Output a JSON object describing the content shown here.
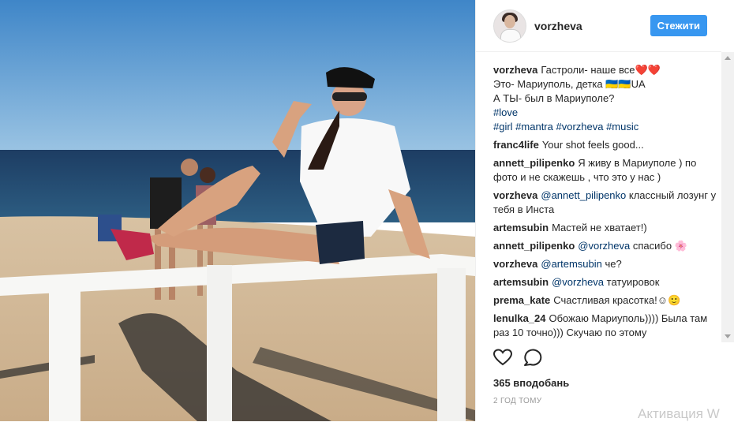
{
  "post": {
    "photo_alt": "",
    "author": "vorzheva",
    "follow_label": "Стежити",
    "caption": {
      "author": "vorzheva",
      "lines": [
        "Гастроли- наше все❤️❤️",
        "Это- Мариуполь, детка 🇺🇦🇺🇦UA",
        "А ТЫ- был в Мариуполе?"
      ],
      "tags_line1": "#love",
      "tags_line2": "#girl #mantra #vorzheva #music"
    },
    "comments": [
      {
        "author": "franc4life",
        "text": "Your shot feels good..."
      },
      {
        "author": "annett_pilipenko",
        "text": "Я живу в Мариуполе ) по фото и не скажешь , что это у нас )"
      },
      {
        "author": "vorzheva",
        "mention": "@annett_pilipenko",
        "text": "классный лозунг у тебя в Инста"
      },
      {
        "author": "artemsubin",
        "text": "Мастей не хватает!)"
      },
      {
        "author": "annett_pilipenko",
        "mention": "@vorzheva",
        "text": "спасибо 🌸"
      },
      {
        "author": "vorzheva",
        "mention": "@artemsubin",
        "text": "че?"
      },
      {
        "author": "artemsubin",
        "mention": "@vorzheva",
        "text": "татуировок"
      },
      {
        "author": "prema_kate",
        "text": "Счастливая красотка!☺🙂"
      },
      {
        "author": "lenulka_24",
        "text": "Обожаю Мариуполь)))) Была там раз 10 точно))) Скучаю по этому"
      }
    ],
    "likes": "365 вподобань",
    "time": "2 ГОД ТОМУ"
  },
  "system": {
    "watermark": "Активация W"
  },
  "icons": [
    "heart-icon",
    "comment-icon"
  ],
  "colors": {
    "follow": "#3897f0",
    "link": "#003569",
    "meta": "#999999"
  }
}
